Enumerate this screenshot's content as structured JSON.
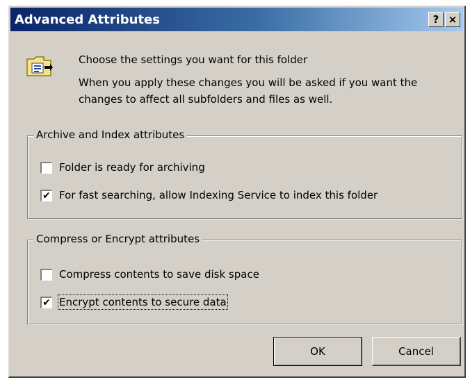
{
  "window": {
    "title": "Advanced Attributes",
    "help_label": "?",
    "close_label": "×"
  },
  "intro": {
    "line1": "Choose the settings you want for this folder",
    "line2": "When you apply these changes you will be asked if you want the changes to affect all subfolders and files as well."
  },
  "archive_group": {
    "legend": "Archive and Index attributes",
    "items": [
      {
        "label": "Folder is ready for archiving",
        "checked": false
      },
      {
        "label": "For fast searching, allow Indexing Service to index this folder",
        "checked": true
      }
    ]
  },
  "compress_group": {
    "legend": "Compress or Encrypt attributes",
    "items": [
      {
        "label": "Compress contents to save disk space",
        "checked": false
      },
      {
        "label": "Encrypt contents to secure data",
        "checked": true
      }
    ]
  },
  "buttons": {
    "ok": "OK",
    "cancel": "Cancel"
  },
  "checkmark": "✔",
  "icons": {
    "folder": "folder-properties-icon"
  }
}
